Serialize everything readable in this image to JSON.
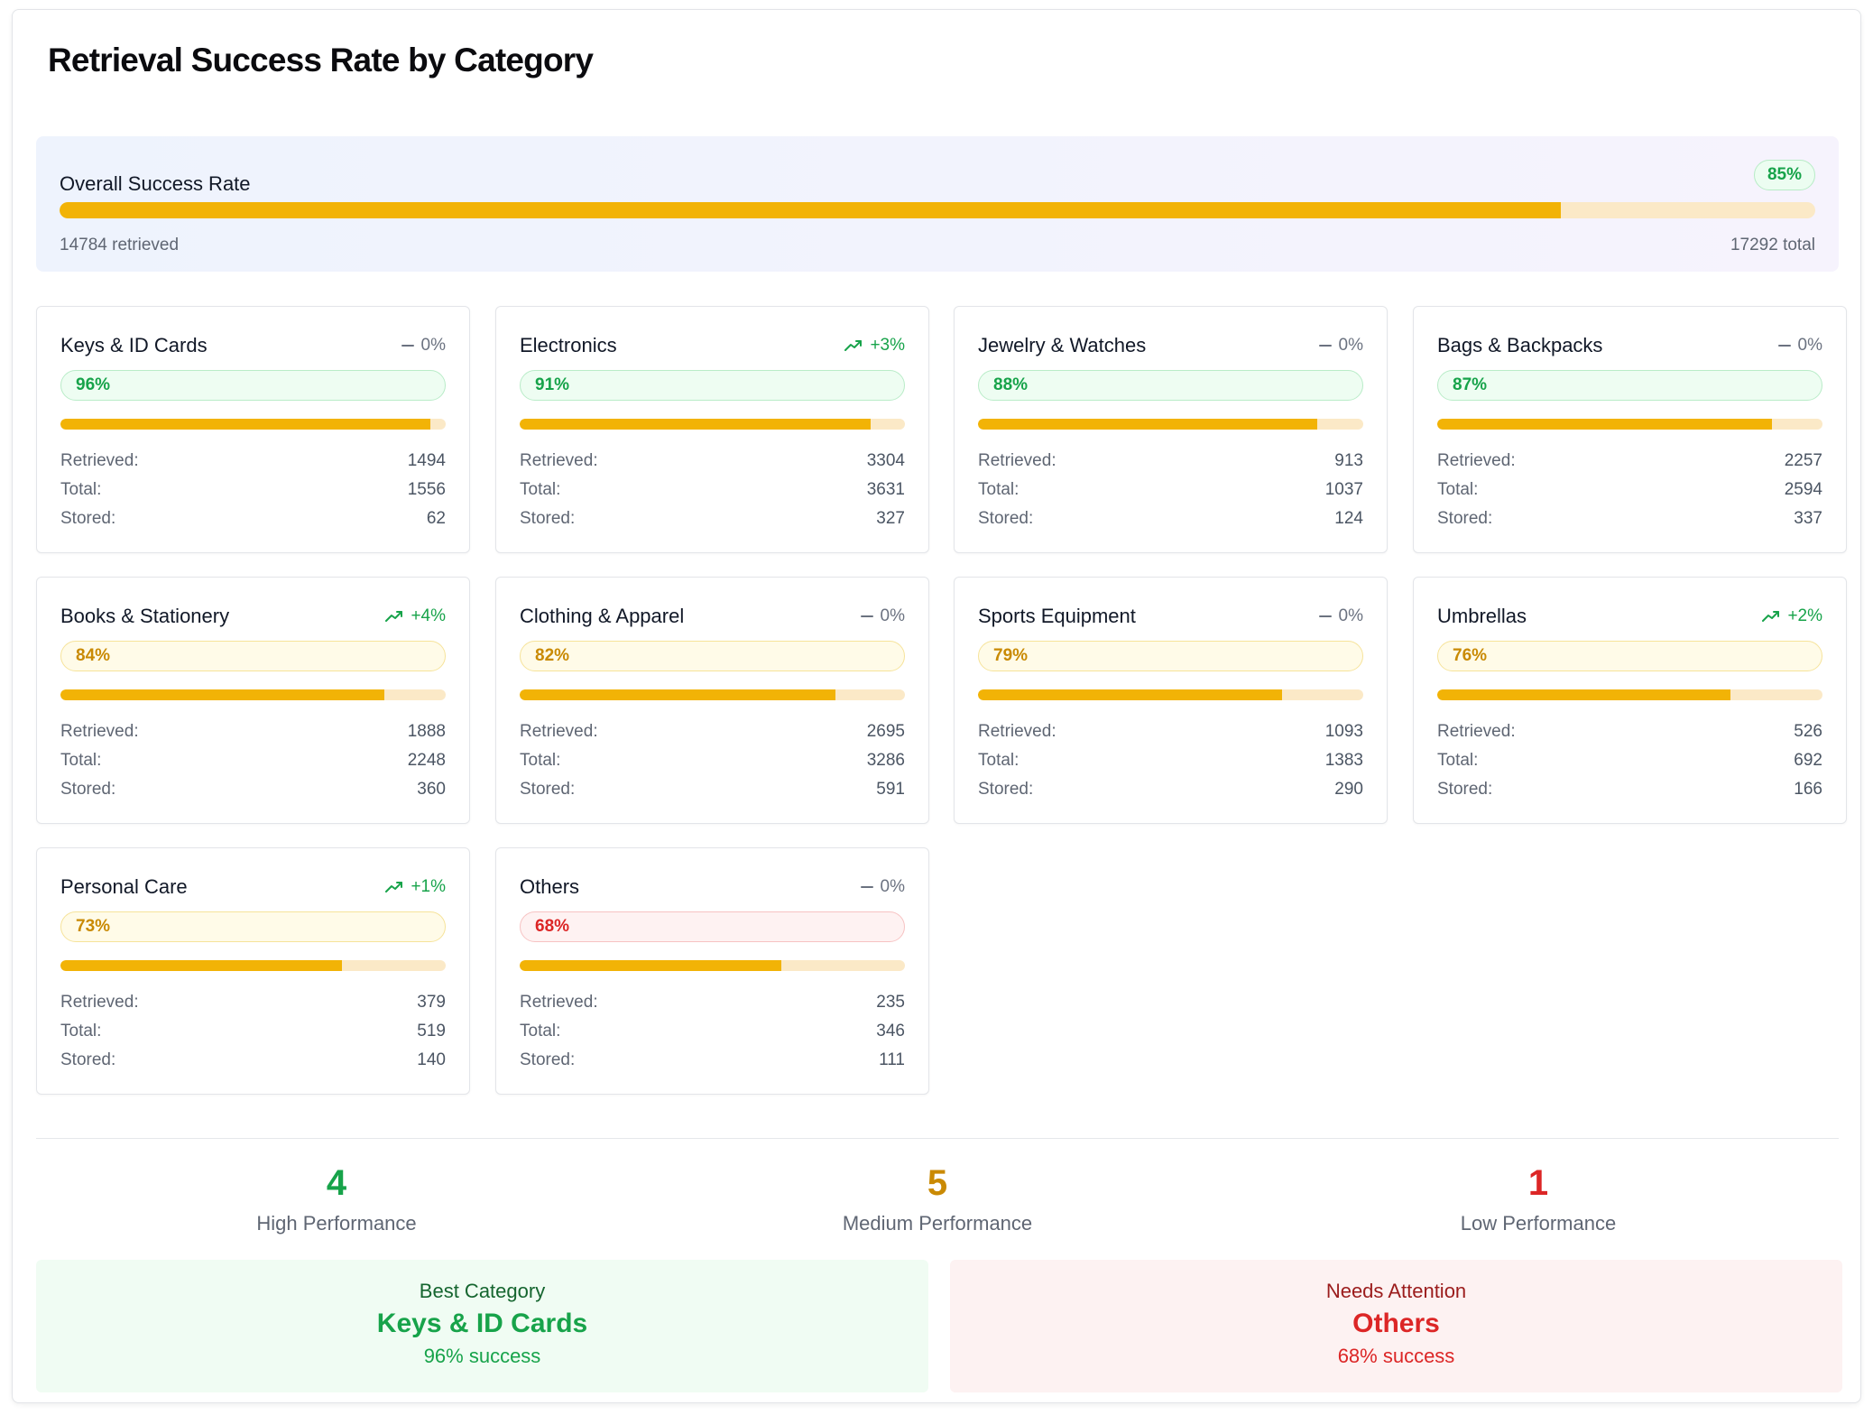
{
  "title": "Retrieval Success Rate by Category",
  "overall": {
    "label": "Overall Success Rate",
    "rate_label": "85%",
    "rate": 0.855,
    "retrieved_text": "14784 retrieved",
    "total_text": "17292 total"
  },
  "labels": {
    "retrieved": "Retrieved:",
    "total": "Total:",
    "stored": "Stored:"
  },
  "categories": [
    {
      "name": "Keys & ID Cards",
      "trend": "0%",
      "trend_dir": "flat",
      "rate_label": "96%",
      "rate": 0.96,
      "level": "high",
      "retrieved": "1494",
      "total": "1556",
      "stored": "62"
    },
    {
      "name": "Electronics",
      "trend": "+3%",
      "trend_dir": "up",
      "rate_label": "91%",
      "rate": 0.91,
      "level": "high",
      "retrieved": "3304",
      "total": "3631",
      "stored": "327"
    },
    {
      "name": "Jewelry & Watches",
      "trend": "0%",
      "trend_dir": "flat",
      "rate_label": "88%",
      "rate": 0.88,
      "level": "high",
      "retrieved": "913",
      "total": "1037",
      "stored": "124"
    },
    {
      "name": "Bags & Backpacks",
      "trend": "0%",
      "trend_dir": "flat",
      "rate_label": "87%",
      "rate": 0.87,
      "level": "high",
      "retrieved": "2257",
      "total": "2594",
      "stored": "337"
    },
    {
      "name": "Books & Stationery",
      "trend": "+4%",
      "trend_dir": "up",
      "rate_label": "84%",
      "rate": 0.84,
      "level": "mid",
      "retrieved": "1888",
      "total": "2248",
      "stored": "360"
    },
    {
      "name": "Clothing & Apparel",
      "trend": "0%",
      "trend_dir": "flat",
      "rate_label": "82%",
      "rate": 0.82,
      "level": "mid",
      "retrieved": "2695",
      "total": "3286",
      "stored": "591"
    },
    {
      "name": "Sports Equipment",
      "trend": "0%",
      "trend_dir": "flat",
      "rate_label": "79%",
      "rate": 0.79,
      "level": "mid",
      "retrieved": "1093",
      "total": "1383",
      "stored": "290"
    },
    {
      "name": "Umbrellas",
      "trend": "+2%",
      "trend_dir": "up",
      "rate_label": "76%",
      "rate": 0.76,
      "level": "mid",
      "retrieved": "526",
      "total": "692",
      "stored": "166"
    },
    {
      "name": "Personal Care",
      "trend": "+1%",
      "trend_dir": "up",
      "rate_label": "73%",
      "rate": 0.73,
      "level": "mid",
      "retrieved": "379",
      "total": "519",
      "stored": "140"
    },
    {
      "name": "Others",
      "trend": "0%",
      "trend_dir": "flat",
      "rate_label": "68%",
      "rate": 0.68,
      "level": "low",
      "retrieved": "235",
      "total": "346",
      "stored": "111"
    }
  ],
  "summary": {
    "high": {
      "count": "4",
      "label": "High Performance",
      "color": "#17a34a"
    },
    "medium": {
      "count": "5",
      "label": "Medium Performance",
      "color": "#ca8a04"
    },
    "low": {
      "count": "1",
      "label": "Low Performance",
      "color": "#dc2626"
    }
  },
  "best": {
    "heading": "Best Category",
    "name": "Keys & ID Cards",
    "sub": "96% success"
  },
  "attention": {
    "heading": "Needs Attention",
    "name": "Others",
    "sub": "68% success"
  },
  "colors": {
    "bar_fill": "#f2b306",
    "bar_track": "#fbe9c7",
    "high": "#17a34a",
    "mid": "#c98a04",
    "low": "#dc2626"
  }
}
